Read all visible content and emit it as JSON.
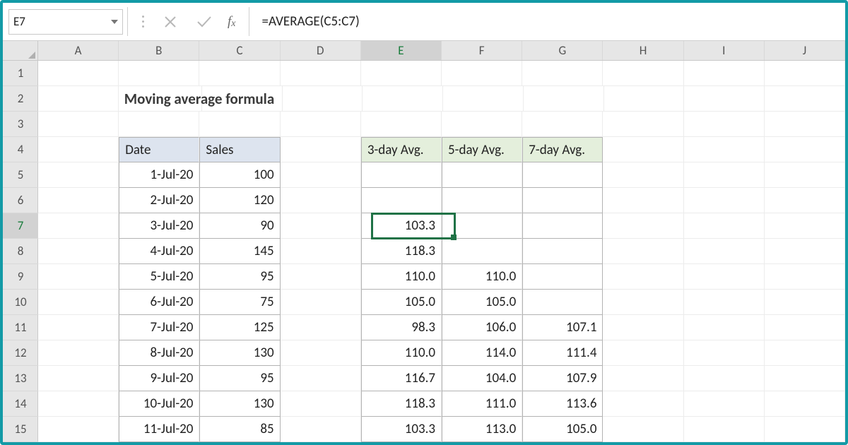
{
  "namebox": {
    "ref": "E7"
  },
  "formula": "=AVERAGE(C5:C7)",
  "columns": [
    "A",
    "B",
    "C",
    "D",
    "E",
    "F",
    "G",
    "H",
    "I",
    "J"
  ],
  "rows": [
    "1",
    "2",
    "3",
    "4",
    "5",
    "6",
    "7",
    "8",
    "9",
    "10",
    "11",
    "12",
    "13",
    "14",
    "15"
  ],
  "active": {
    "col": "E",
    "row": "7"
  },
  "title": "Moving average formula",
  "headers1": {
    "date": "Date",
    "sales": "Sales"
  },
  "headers2": {
    "d3": "3-day Avg.",
    "d5": "5-day Avg.",
    "d7": "7-day Avg."
  },
  "data": [
    {
      "date": "1-Jul-20",
      "sales": "100",
      "d3": "",
      "d5": "",
      "d7": ""
    },
    {
      "date": "2-Jul-20",
      "sales": "120",
      "d3": "",
      "d5": "",
      "d7": ""
    },
    {
      "date": "3-Jul-20",
      "sales": "90",
      "d3": "103.3",
      "d5": "",
      "d7": ""
    },
    {
      "date": "4-Jul-20",
      "sales": "145",
      "d3": "118.3",
      "d5": "",
      "d7": ""
    },
    {
      "date": "5-Jul-20",
      "sales": "95",
      "d3": "110.0",
      "d5": "110.0",
      "d7": ""
    },
    {
      "date": "6-Jul-20",
      "sales": "75",
      "d3": "105.0",
      "d5": "105.0",
      "d7": ""
    },
    {
      "date": "7-Jul-20",
      "sales": "125",
      "d3": "98.3",
      "d5": "106.0",
      "d7": "107.1"
    },
    {
      "date": "8-Jul-20",
      "sales": "130",
      "d3": "110.0",
      "d5": "114.0",
      "d7": "111.4"
    },
    {
      "date": "9-Jul-20",
      "sales": "95",
      "d3": "116.7",
      "d5": "104.0",
      "d7": "107.9"
    },
    {
      "date": "10-Jul-20",
      "sales": "130",
      "d3": "118.3",
      "d5": "111.0",
      "d7": "113.6"
    },
    {
      "date": "11-Jul-20",
      "sales": "85",
      "d3": "103.3",
      "d5": "113.0",
      "d7": "105.0"
    }
  ]
}
